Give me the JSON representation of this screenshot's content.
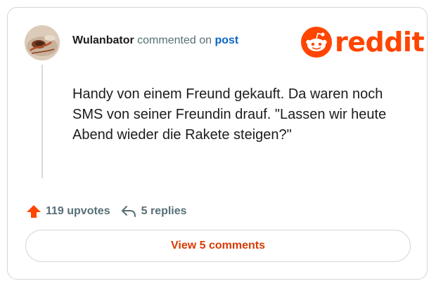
{
  "comment": {
    "author": "Wulanbator",
    "action_text": "commented on",
    "post_link_text": "post",
    "body": "Handy von einem Freund gekauft. Da waren noch SMS von seiner Freundin drauf. \"Lassen wir heute Abend wieder die Rakete steigen?\""
  },
  "brand": {
    "wordmark": "reddit",
    "icon": "reddit-snoo-icon",
    "color": "#ff4500"
  },
  "stats": {
    "upvotes_label": "119 upvotes",
    "upvote_icon": "upvote-arrow-icon",
    "upvote_color": "#ff4500",
    "replies_label": "5 replies",
    "replies_icon": "reply-arrow-icon"
  },
  "actions": {
    "view_comments_label": "View 5 comments",
    "accent_color": "#d93a00"
  }
}
